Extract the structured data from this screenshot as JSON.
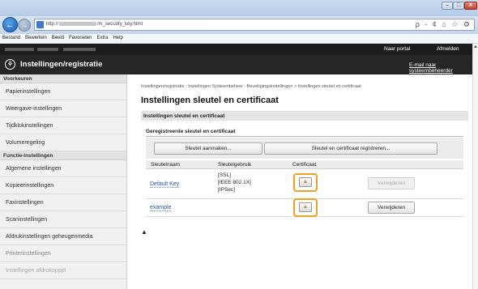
{
  "browser": {
    "url_prefix": "http://",
    "url_suffix": "/m_security_key.html",
    "tools": "ρ - ¢  ⌂ ☆ ⚙",
    "window_buttons": {
      "minimize": "–",
      "maximize": "□",
      "close": "X"
    },
    "nav": {
      "back": "←",
      "forward": "→"
    }
  },
  "menu": {
    "items": [
      "Bestand",
      "Bewerken",
      "Beeld",
      "Favorieten",
      "Extra",
      "Help"
    ]
  },
  "topstrip": {
    "portal": "Naar portal",
    "logout": "Afmelden"
  },
  "appheader": {
    "icon": "⚘",
    "title": "Instellingen/registratie",
    "email": "E-mail naar systeembeheerder"
  },
  "sidebar": {
    "preferences_heading": "Voorkeuren",
    "preferences": [
      "Papierinstellingen",
      "Weergave-instellingen",
      "Tijdklokinstellingen",
      "Volumeregeling"
    ],
    "functions_heading": "Functie-instellingen",
    "functions": [
      "Algemene instellingen",
      "Kopieerinstellingen",
      "Faxinstellingen",
      "Scaninstellingen",
      "Afdrukinstellingen geheugenmedia",
      "Printerinstellingen",
      "Instellingen afdrukopppt"
    ]
  },
  "main": {
    "breadcrumb": "Instellingen/registratie : Instellingen Systeembeheer : Beveiligingsinstellingen > Instellingen sleutel en certificaat",
    "title": "Instellingen sleutel en certificaat",
    "section": "Instellingen sleutel en certificaat",
    "subheading": "Geregistreerde sleutel en certificaat",
    "buttons": {
      "generate": "Sleutel aanmaken...",
      "register": "Sleutel en certificaat registreren..."
    },
    "columns": {
      "name": "Sleutelnaam",
      "usage": "Sleutelgebruik",
      "certificate": "Certificaat"
    },
    "rows": [
      {
        "name": "Default Key",
        "usage": [
          "[SSL]",
          "[IEEE 802.1X]",
          "[IPSec]"
        ],
        "delete": "Verwijderen",
        "delete_enabled": false
      },
      {
        "name": "example",
        "usage": [],
        "delete": "Verwijderen",
        "delete_enabled": true
      }
    ],
    "to_top": "▲"
  },
  "colors": {
    "header_bg": "#262626",
    "highlight": "#f0a020",
    "link": "#2255aa"
  }
}
